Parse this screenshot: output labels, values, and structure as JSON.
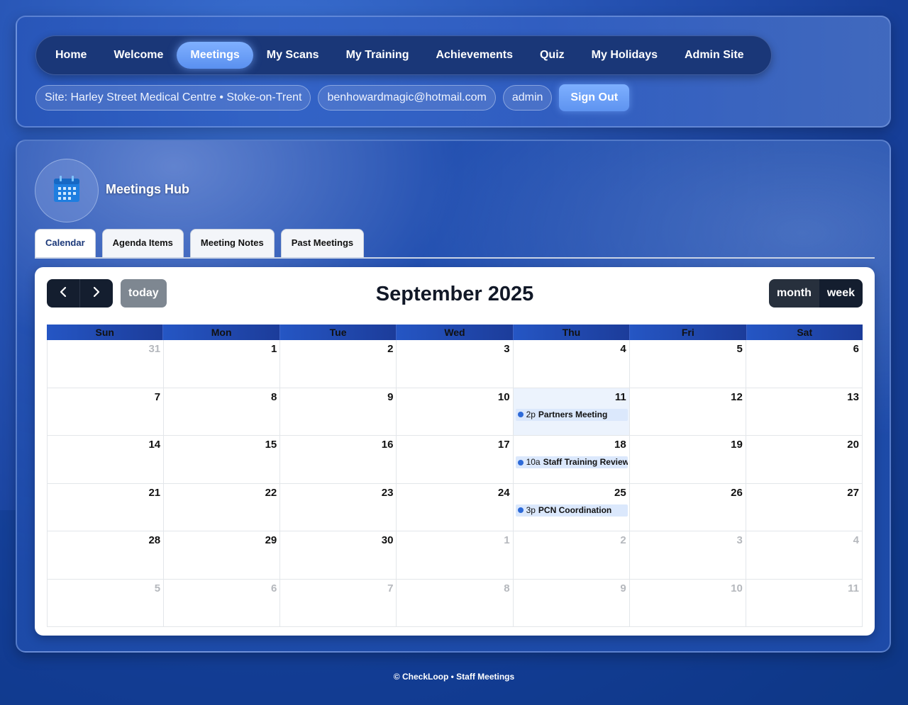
{
  "nav": {
    "items": [
      {
        "label": "Home",
        "active": false
      },
      {
        "label": "Welcome",
        "active": false
      },
      {
        "label": "Meetings",
        "active": true
      },
      {
        "label": "My Scans",
        "active": false
      },
      {
        "label": "My Training",
        "active": false
      },
      {
        "label": "Achievements",
        "active": false
      },
      {
        "label": "Quiz",
        "active": false
      },
      {
        "label": "My Holidays",
        "active": false
      },
      {
        "label": "Admin Site",
        "active": false
      }
    ]
  },
  "user_bar": {
    "site": "Site: Harley Street Medical Centre • Stoke-on-Trent",
    "email": "benhowardmagic@hotmail.com",
    "role": "admin",
    "sign_out": "Sign Out"
  },
  "hub": {
    "title": "Meetings Hub",
    "icon": "calendar-icon"
  },
  "tabs": [
    {
      "label": "Calendar",
      "active": true
    },
    {
      "label": "Agenda Items",
      "active": false
    },
    {
      "label": "Meeting Notes",
      "active": false
    },
    {
      "label": "Past Meetings",
      "active": false
    }
  ],
  "calendar": {
    "title": "September 2025",
    "today_label": "today",
    "views": [
      {
        "label": "month",
        "active": true
      },
      {
        "label": "week",
        "active": false
      }
    ],
    "weekdays": [
      "Sun",
      "Mon",
      "Tue",
      "Wed",
      "Thu",
      "Fri",
      "Sat"
    ],
    "weeks": [
      [
        {
          "d": "31",
          "other": true
        },
        {
          "d": "1"
        },
        {
          "d": "2"
        },
        {
          "d": "3"
        },
        {
          "d": "4"
        },
        {
          "d": "5"
        },
        {
          "d": "6"
        }
      ],
      [
        {
          "d": "7"
        },
        {
          "d": "8"
        },
        {
          "d": "9"
        },
        {
          "d": "10"
        },
        {
          "d": "11",
          "today": true,
          "event": {
            "time": "2p",
            "title": "Partners Meeting"
          }
        },
        {
          "d": "12"
        },
        {
          "d": "13"
        }
      ],
      [
        {
          "d": "14"
        },
        {
          "d": "15"
        },
        {
          "d": "16"
        },
        {
          "d": "17"
        },
        {
          "d": "18",
          "event": {
            "time": "10a",
            "title": "Staff Training Review"
          }
        },
        {
          "d": "19"
        },
        {
          "d": "20"
        }
      ],
      [
        {
          "d": "21"
        },
        {
          "d": "22"
        },
        {
          "d": "23"
        },
        {
          "d": "24"
        },
        {
          "d": "25",
          "event": {
            "time": "3p",
            "title": "PCN Coordination"
          }
        },
        {
          "d": "26"
        },
        {
          "d": "27"
        }
      ],
      [
        {
          "d": "28"
        },
        {
          "d": "29"
        },
        {
          "d": "30"
        },
        {
          "d": "1",
          "other": true
        },
        {
          "d": "2",
          "other": true
        },
        {
          "d": "3",
          "other": true
        },
        {
          "d": "4",
          "other": true
        }
      ],
      [
        {
          "d": "5",
          "other": true
        },
        {
          "d": "6",
          "other": true
        },
        {
          "d": "7",
          "other": true
        },
        {
          "d": "8",
          "other": true
        },
        {
          "d": "9",
          "other": true
        },
        {
          "d": "10",
          "other": true
        },
        {
          "d": "11",
          "other": true
        }
      ]
    ],
    "event_color": "#2d6ad8"
  },
  "footer": "© CheckLoop • Staff Meetings"
}
